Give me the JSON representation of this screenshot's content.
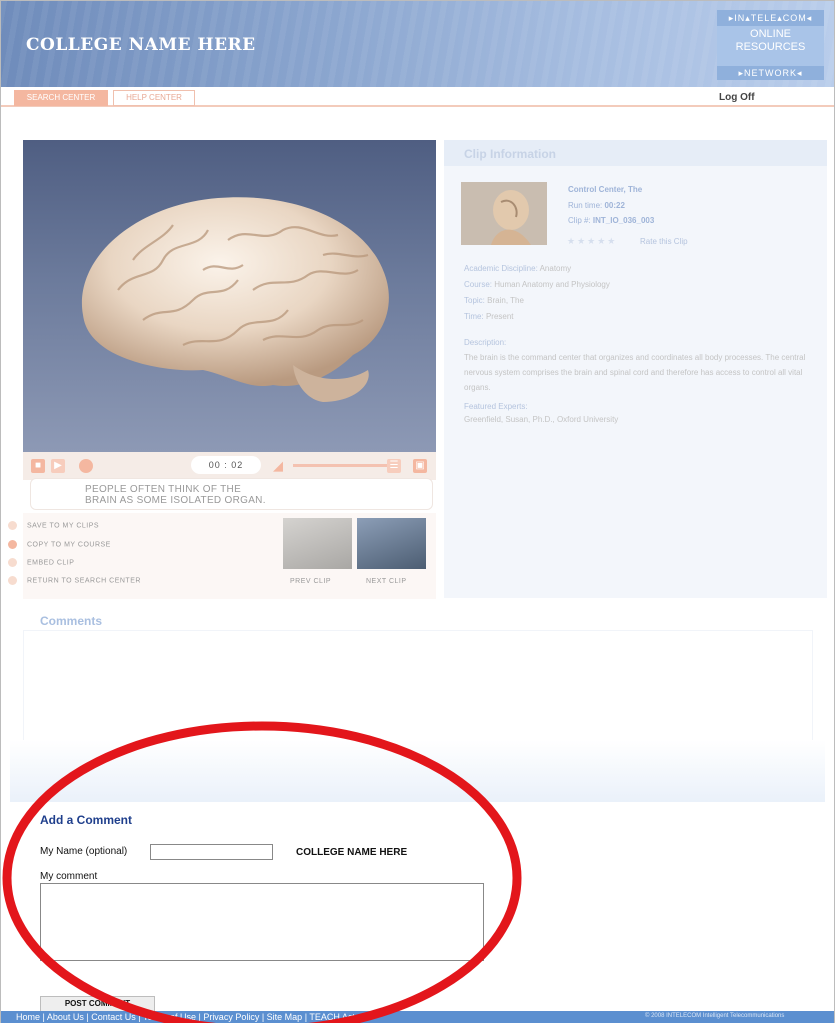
{
  "header": {
    "college_name": "COLLEGE NAME HERE",
    "brand_top": "▸IN▴TELE▴COM◂",
    "brand_mid_line1": "ONLINE",
    "brand_mid_line2": "RESOURCES",
    "brand_bottom": "▸NETWORK◂"
  },
  "nav": {
    "tab_search": "SEARCH CENTER",
    "tab_help": "HELP CENTER",
    "logoff": "Log Off"
  },
  "player": {
    "time": "00 : 02",
    "caption_line1": "PEOPLE OFTEN THINK OF THE",
    "caption_line2": "BRAIN AS SOME ISOLATED ORGAN.",
    "actions": {
      "save": "SAVE TO MY CLIPS",
      "copy": "COPY TO MY COURSE",
      "embed": "EMBED CLIP",
      "return": "RETURN TO SEARCH CENTER"
    },
    "prev_clip": "PREV CLIP",
    "next_clip": "NEXT CLIP"
  },
  "clip_info": {
    "title": "Clip Information",
    "clip_name": "Control Center, The",
    "run_time_label": "Run time:",
    "run_time": "00:22",
    "clip_id_label": "Clip #:",
    "clip_id": "INT_IO_036_003",
    "rate": "Rate this Clip",
    "discipline_label": "Academic Discipline:",
    "discipline": "Anatomy",
    "course_label": "Course:",
    "course": "Human Anatomy and Physiology",
    "topic_label": "Topic:",
    "topic": "Brain, The",
    "time_label": "Time:",
    "time": "Present",
    "description_label": "Description:",
    "description": "The brain is the command center that organizes and coordinates all body processes. The central nervous system comprises the brain and spinal cord and therefore has access to control all vital organs.",
    "experts_label": "Featured Experts:",
    "experts": "Greenfield, Susan, Ph.D., Oxford University"
  },
  "comments": {
    "title": "Comments",
    "add_title": "Add a Comment",
    "name_label": "My Name (optional)",
    "college_inline": "COLLEGE NAME HERE",
    "comment_label": "My comment",
    "post_button": "POST COMMENT",
    "name_value": "",
    "comment_value": ""
  },
  "footer": {
    "links": [
      "Home",
      "About Us",
      "Contact Us",
      "Terms of Use",
      "Privacy Policy",
      "Site Map",
      "TEACH Act"
    ],
    "copyright": "© 2008 INTELECOM Intelligent Telecommunications"
  },
  "colors": {
    "header_blue": "#6f8cbb",
    "nav_salmon": "#f4b7a0",
    "add_comment_blue": "#1f3f8c",
    "footer_blue": "#5b8fd0",
    "highlight_red": "#e3161b"
  }
}
